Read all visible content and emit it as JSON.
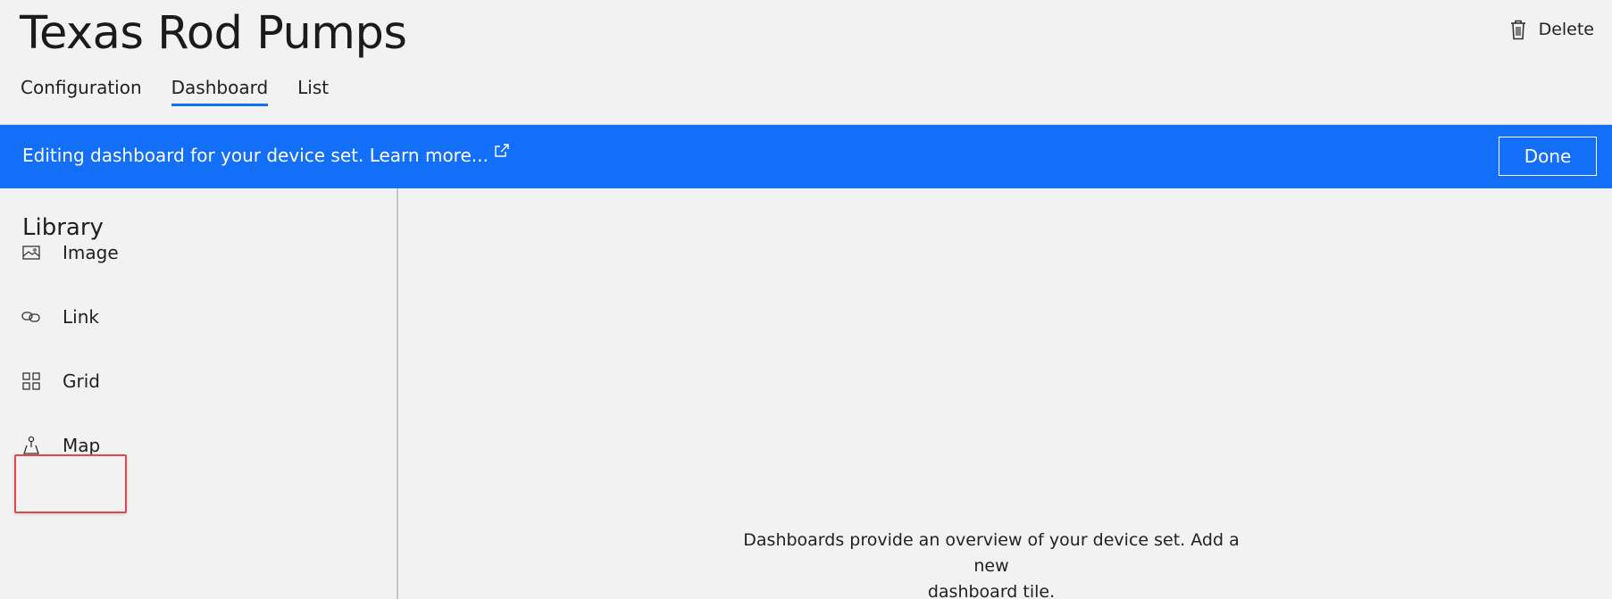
{
  "header": {
    "title": "Texas Rod Pumps",
    "delete_label": "Delete",
    "delete_icon": "trash-icon"
  },
  "tabs": [
    {
      "label": "Configuration",
      "active": false
    },
    {
      "label": "Dashboard",
      "active": true
    },
    {
      "label": "List",
      "active": false
    }
  ],
  "banner": {
    "text": "Editing dashboard for your device set.",
    "link_label": "Learn more...",
    "link_icon": "external-link-icon",
    "done_label": "Done",
    "color": "#136ff8"
  },
  "library": {
    "title": "Library",
    "items": [
      {
        "label": "Image",
        "icon": "image-icon"
      },
      {
        "label": "Link",
        "icon": "link-icon"
      },
      {
        "label": "Grid",
        "icon": "grid-icon"
      },
      {
        "label": "Map",
        "icon": "map-icon",
        "highlighted": true
      }
    ]
  },
  "canvas": {
    "empty_message_line1": "Dashboards provide an overview of your device set. Add a new",
    "empty_message_line2": "dashboard tile."
  },
  "colors": {
    "accent": "#1570f5",
    "highlight": "#e0474c",
    "background": "#f2f2f2"
  }
}
